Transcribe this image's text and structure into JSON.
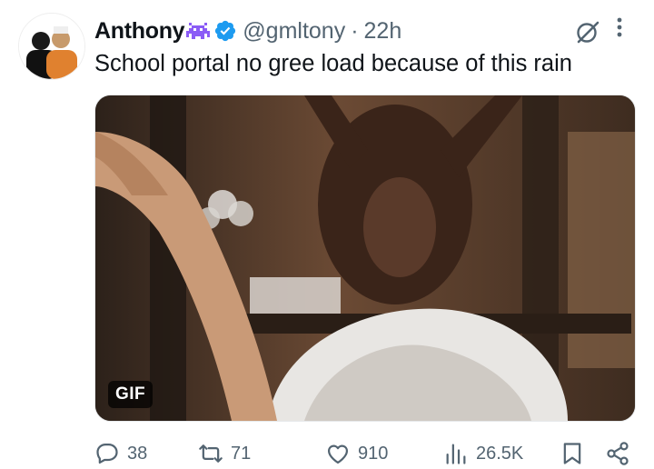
{
  "author": {
    "display_name": "Anthony",
    "name_emoji": "alien-invader-emoji",
    "verified": true,
    "handle": "@gmltony",
    "separator": "·",
    "time": "22h"
  },
  "tweet": {
    "text": "School portal no gree load because of this rain"
  },
  "media": {
    "badge": "GIF"
  },
  "actions": {
    "replies": "38",
    "reposts": "71",
    "likes": "910",
    "views": "26.5K"
  },
  "icons": [
    "grok-icon",
    "more-icon",
    "reply-icon",
    "repost-icon",
    "like-icon",
    "views-icon",
    "bookmark-icon",
    "share-icon"
  ],
  "colors": {
    "text": "#0f1419",
    "secondary": "#536471",
    "verified": "#1d9bf0",
    "emoji": "#8b5cf6"
  }
}
